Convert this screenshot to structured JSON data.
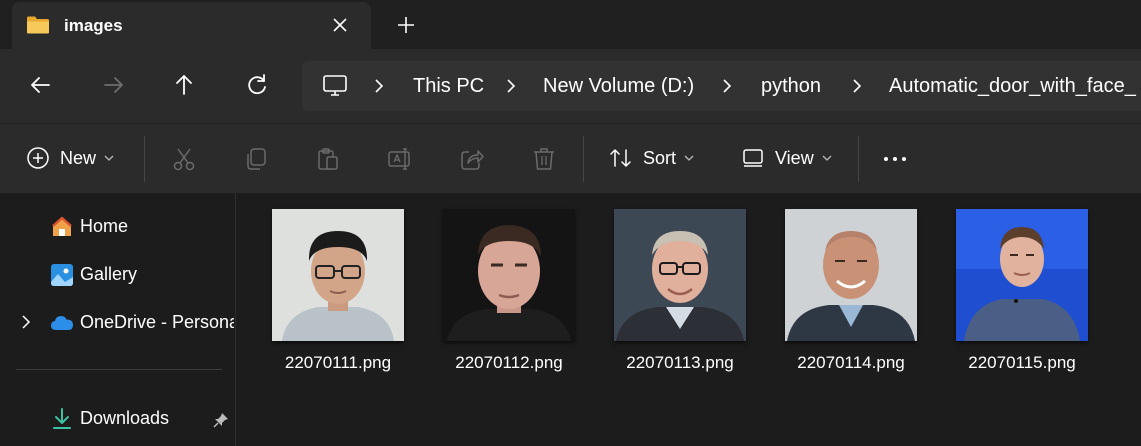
{
  "tab": {
    "title": "images",
    "folder_icon": "folder-icon",
    "close_icon": "close-icon"
  },
  "new_tab_icon": "plus-icon",
  "nav": {
    "back_icon": "arrow-left-icon",
    "forward_icon": "arrow-right-icon",
    "up_icon": "arrow-up-icon",
    "refresh_icon": "refresh-icon"
  },
  "breadcrumb": {
    "root_icon": "monitor-icon",
    "items": [
      "This PC",
      "New Volume (D:)",
      "python",
      "Automatic_door_with_face_"
    ]
  },
  "toolbar": {
    "new_label": "New",
    "sort_label": "Sort",
    "view_label": "View",
    "icons": [
      "cut-icon",
      "copy-icon",
      "paste-icon",
      "rename-icon",
      "share-icon",
      "delete-icon",
      "more-icon"
    ]
  },
  "sidebar": {
    "items": [
      {
        "label": "Home",
        "icon": "home-icon"
      },
      {
        "label": "Gallery",
        "icon": "gallery-icon"
      },
      {
        "label": "OneDrive - Persona",
        "icon": "cloud-icon"
      },
      {
        "label": "Downloads",
        "icon": "download-icon"
      }
    ]
  },
  "files": [
    {
      "name": "22070111.png"
    },
    {
      "name": "22070112.png"
    },
    {
      "name": "22070113.png"
    },
    {
      "name": "22070114.png"
    },
    {
      "name": "22070115.png"
    }
  ],
  "colors": {
    "window_bg": "#1c1c1c",
    "chrome_bg": "#2b2b2b",
    "accent_folder": "#f4c152",
    "accent_blue": "#4aa3df"
  }
}
